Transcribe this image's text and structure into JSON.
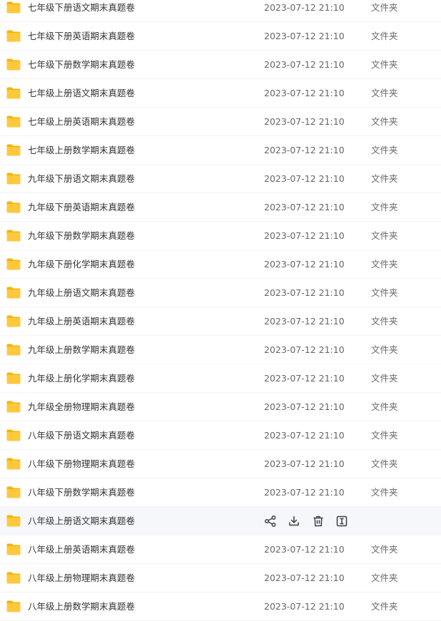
{
  "files": [
    {
      "name": "七年级下册语文期末真题卷",
      "date": "2023-07-12 21:10",
      "type": "文件夹"
    },
    {
      "name": "七年级下册英语期末真题卷",
      "date": "2023-07-12 21:10",
      "type": "文件夹"
    },
    {
      "name": "七年级下册数学期末真题卷",
      "date": "2023-07-12 21:10",
      "type": "文件夹"
    },
    {
      "name": "七年级上册语文期末真题卷",
      "date": "2023-07-12 21:10",
      "type": "文件夹"
    },
    {
      "name": "七年级上册英语期末真题卷",
      "date": "2023-07-12 21:10",
      "type": "文件夹"
    },
    {
      "name": "七年级上册数学期末真题卷",
      "date": "2023-07-12 21:10",
      "type": "文件夹"
    },
    {
      "name": "九年级下册语文期末真题卷",
      "date": "2023-07-12 21:10",
      "type": "文件夹"
    },
    {
      "name": "九年级下册英语期末真题卷",
      "date": "2023-07-12 21:10",
      "type": "文件夹"
    },
    {
      "name": "九年级下册数学期末真题卷",
      "date": "2023-07-12 21:10",
      "type": "文件夹"
    },
    {
      "name": "九年级下册化学期末真题卷",
      "date": "2023-07-12 21:10",
      "type": "文件夹"
    },
    {
      "name": "九年级上册语文期末真题卷",
      "date": "2023-07-12 21:10",
      "type": "文件夹"
    },
    {
      "name": "九年级上册英语期末真题卷",
      "date": "2023-07-12 21:10",
      "type": "文件夹"
    },
    {
      "name": "九年级上册数学期末真题卷",
      "date": "2023-07-12 21:10",
      "type": "文件夹"
    },
    {
      "name": "九年级上册化学期末真题卷",
      "date": "2023-07-12 21:10",
      "type": "文件夹"
    },
    {
      "name": "九年级全册物理期末真题卷",
      "date": "2023-07-12 21:10",
      "type": "文件夹"
    },
    {
      "name": "八年级下册语文期末真题卷",
      "date": "2023-07-12 21:10",
      "type": "文件夹"
    },
    {
      "name": "八年级下册物理期末真题卷",
      "date": "2023-07-12 21:10",
      "type": "文件夹"
    },
    {
      "name": "八年级下册数学期末真题卷",
      "date": "2023-07-12 21:10",
      "type": "文件夹"
    },
    {
      "name": "八年级上册语文期末真题卷",
      "date": "",
      "type": "",
      "hovered": true
    },
    {
      "name": "八年级上册英语期末真题卷",
      "date": "2023-07-12 21:10",
      "type": "文件夹"
    },
    {
      "name": "八年级上册物理期末真题卷",
      "date": "2023-07-12 21:10",
      "type": "文件夹"
    },
    {
      "name": "八年级上册数学期末真题卷",
      "date": "2023-07-12 21:10",
      "type": "文件夹"
    }
  ],
  "row_icon": "folder-icon",
  "hover_actions": [
    {
      "icon": "share-icon"
    },
    {
      "icon": "download-icon"
    },
    {
      "icon": "delete-icon"
    },
    {
      "icon": "rename-icon"
    }
  ],
  "colors": {
    "folder": "#ffc83d",
    "folder_tab": "#f5b400",
    "hover_bg": "#f5f7fa",
    "name_text": "#333333",
    "meta_text": "#666666",
    "action_icon": "#3a3f4a"
  }
}
